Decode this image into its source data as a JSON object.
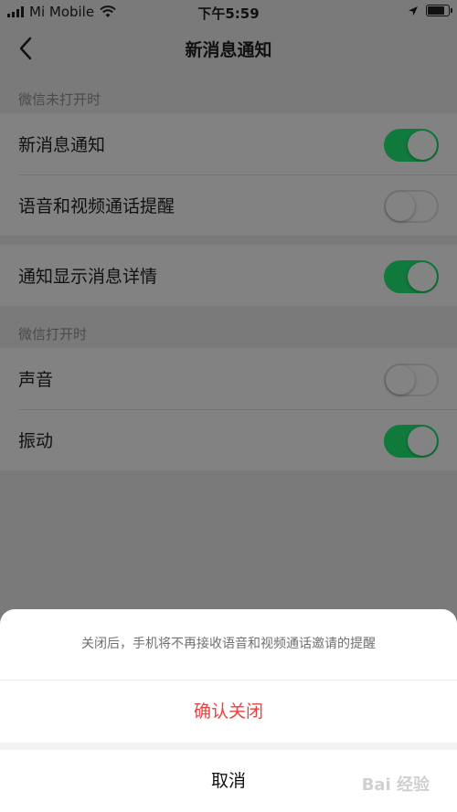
{
  "status_bar": {
    "carrier": "Mi Mobile",
    "time": "下午5:59",
    "battery_level_pct": 95,
    "icons": [
      "signal-bars-icon",
      "wifi-icon",
      "location-arrow-icon",
      "battery-icon"
    ]
  },
  "nav": {
    "title": "新消息通知",
    "back_icon": "chevron-left-icon"
  },
  "sections": [
    {
      "header": "微信未打开时",
      "rows": [
        {
          "label": "新消息通知",
          "on": true
        },
        {
          "label": "语音和视频通话提醒",
          "on": false
        }
      ]
    },
    {
      "header": "",
      "rows": [
        {
          "label": "通知显示消息详情",
          "on": true
        }
      ]
    },
    {
      "header": "微信打开时",
      "rows": [
        {
          "label": "声音",
          "on": false
        },
        {
          "label": "振动",
          "on": true
        }
      ]
    }
  ],
  "action_sheet": {
    "message": "关闭后，手机将不再接收语音和视频通话邀请的提醒",
    "confirm_label": "确认关闭",
    "cancel_label": "取消"
  },
  "colors": {
    "toggle_on": "#107a3c",
    "destructive": "#e64340"
  },
  "watermark": "Bai 经验"
}
